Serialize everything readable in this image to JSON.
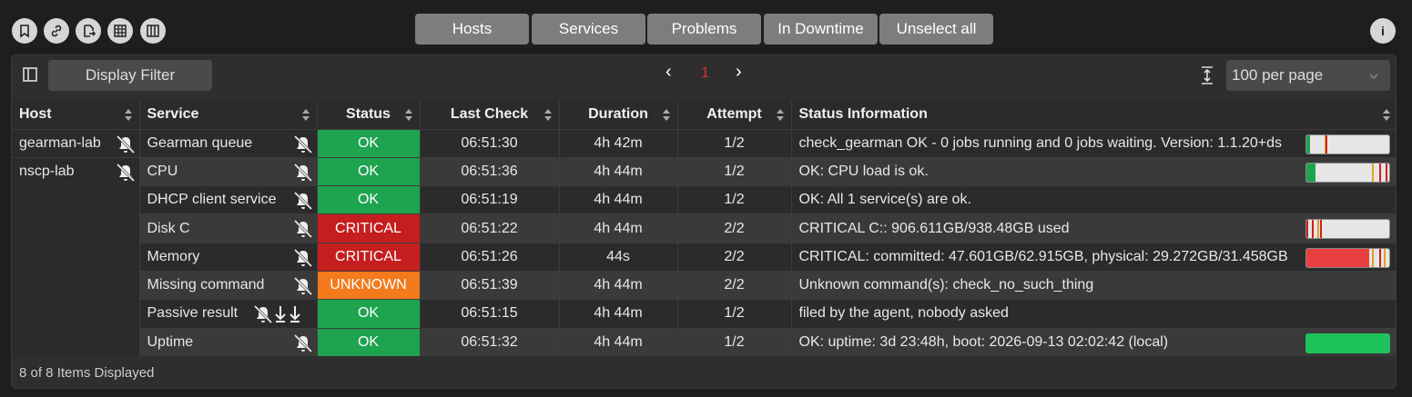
{
  "toolbar_icons": [
    "bookmark-icon",
    "link-icon",
    "export-icon",
    "grid-icon",
    "columns-icon"
  ],
  "nav": {
    "hosts": "Hosts",
    "services": "Services",
    "problems": "Problems",
    "in_downtime": "In Downtime",
    "unselect_all": "Unselect all"
  },
  "info_label": "i",
  "filter": {
    "label": "Display Filter"
  },
  "pager": {
    "prev": "‹",
    "page": "1",
    "next": "›"
  },
  "perpage": {
    "value": "100 per page"
  },
  "columns": {
    "host": "Host",
    "service": "Service",
    "status": "Status",
    "last_check": "Last Check",
    "duration": "Duration",
    "attempt": "Attempt",
    "status_info": "Status Information"
  },
  "hosts": [
    "gearman-lab",
    "nscp-lab"
  ],
  "rows": [
    {
      "service": "Gearman queue",
      "status": "OK",
      "last_check": "06:51:30",
      "duration": "4h 42m",
      "attempt": "1/2",
      "info": "check_gearman OK - 0 jobs running and 0 jobs waiting. Version: 1.1.20+ds"
    },
    {
      "service": "CPU",
      "status": "OK",
      "last_check": "06:51:36",
      "duration": "4h 44m",
      "attempt": "1/2",
      "info": "OK: CPU load is ok."
    },
    {
      "service": "DHCP client service",
      "status": "OK",
      "last_check": "06:51:19",
      "duration": "4h 44m",
      "attempt": "1/2",
      "info": "OK: All 1 service(s) are ok."
    },
    {
      "service": "Disk C",
      "status": "CRITICAL",
      "last_check": "06:51:22",
      "duration": "4h 44m",
      "attempt": "2/2",
      "info": "CRITICAL C:: 906.611GB/938.48GB used"
    },
    {
      "service": "Memory",
      "status": "CRITICAL",
      "last_check": "06:51:26",
      "duration": "44s",
      "attempt": "2/2",
      "info": "CRITICAL: committed: 47.601GB/62.915GB, physical: 29.272GB/31.458GB"
    },
    {
      "service": "Missing command",
      "status": "UNKNOWN",
      "last_check": "06:51:39",
      "duration": "4h 44m",
      "attempt": "2/2",
      "info": "Unknown command(s): check_no_such_thing"
    },
    {
      "service": "Passive result",
      "status": "OK",
      "last_check": "06:51:15",
      "duration": "4h 44m",
      "attempt": "1/2",
      "info": "filed by the agent, nobody asked"
    },
    {
      "service": "Uptime",
      "status": "OK",
      "last_check": "06:51:32",
      "duration": "4h 44m",
      "attempt": "1/2",
      "info": "OK: uptime: 3d 23:48h, boot: 2026-09-13 02:02:42 (local)"
    }
  ],
  "footer": {
    "count": "8 of 8 Items Displayed"
  },
  "colors": {
    "ok": "#1ea34f",
    "critical": "#c41e1e",
    "unknown": "#f47a1c",
    "warn_marker": "#e0a020",
    "crit_marker": "#d02020"
  }
}
